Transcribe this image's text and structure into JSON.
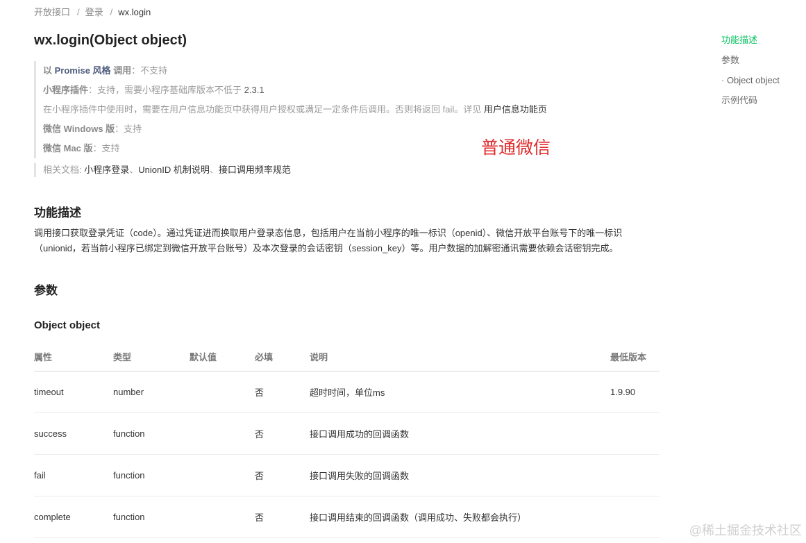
{
  "breadcrumb": [
    "开放接口",
    "登录",
    "wx.login"
  ],
  "page_title": "wx.login(Object object)",
  "notes": {
    "promise_prefix": "以 ",
    "promise_em": "Promise 风格",
    "promise_suffix": " 调用",
    "promise_value": "：不支持",
    "plugin_label": "小程序插件",
    "plugin_value": "：支持，需要小程序基础库版本不低于 ",
    "plugin_version": "2.3.1",
    "plugin_detail": "在小程序插件中使用时，需要在用户信息功能页中获得用户授权或满足一定条件后调用。否则将返回 fail。详见 ",
    "plugin_link": "用户信息功能页",
    "windows_label": "微信 Windows 版",
    "windows_value": "：支持",
    "mac_label": "微信 Mac 版",
    "mac_value": "：支持"
  },
  "related": {
    "label": "相关文档: ",
    "link1": "小程序登录",
    "link2": "UnionID 机制说明",
    "link3": "接口调用频率规范",
    "separator": "、"
  },
  "stamp": "普通微信",
  "section_desc": {
    "title": "功能描述",
    "text": "调用接口获取登录凭证（code）。通过凭证进而换取用户登录态信息，包括用户在当前小程序的唯一标识（openid）、微信开放平台账号下的唯一标识（unionid，若当前小程序已绑定到微信开放平台账号）及本次登录的会话密钥（session_key）等。用户数据的加解密通讯需要依赖会话密钥完成。"
  },
  "section_params": {
    "title": "参数",
    "subtitle": "Object object"
  },
  "table": {
    "headers": [
      "属性",
      "类型",
      "默认值",
      "必填",
      "说明",
      "最低版本"
    ],
    "rows": [
      [
        "timeout",
        "number",
        "",
        "否",
        "超时时间，单位ms",
        "1.9.90"
      ],
      [
        "success",
        "function",
        "",
        "否",
        "接口调用成功的回调函数",
        ""
      ],
      [
        "fail",
        "function",
        "",
        "否",
        "接口调用失败的回调函数",
        ""
      ],
      [
        "complete",
        "function",
        "",
        "否",
        "接口调用结束的回调函数（调用成功、失败都会执行）",
        ""
      ]
    ]
  },
  "toc": [
    "功能描述",
    "参数",
    "· Object object",
    "示例代码"
  ],
  "watermark": "@稀土掘金技术社区",
  "colors": {
    "accent": "#07c160",
    "stamp": "#e0292a",
    "emphasis": "#4d5b7c"
  }
}
